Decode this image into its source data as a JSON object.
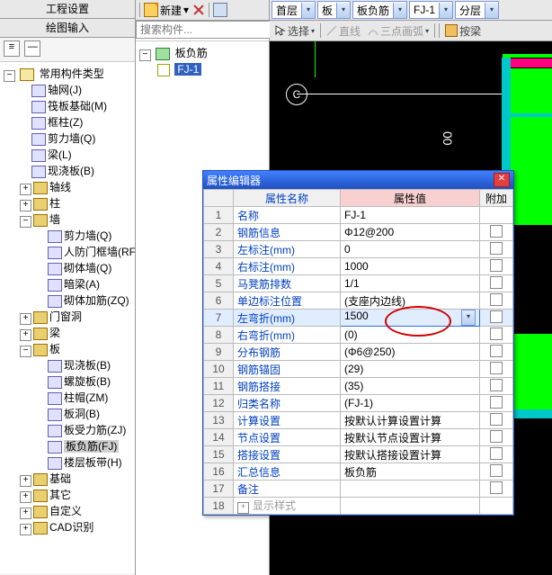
{
  "left": {
    "tab1": "工程设置",
    "tab2": "绘图输入",
    "root": "常用构件类型",
    "items": [
      {
        "label": "轴网(J)"
      },
      {
        "label": "筏板基础(M)"
      },
      {
        "label": "框柱(Z)"
      },
      {
        "label": "剪力墙(Q)"
      },
      {
        "label": "梁(L)"
      },
      {
        "label": "现浇板(B)"
      }
    ],
    "groups": [
      {
        "label": "轴线",
        "exp": "plus"
      },
      {
        "label": "柱",
        "exp": "plus"
      },
      {
        "label": "墙",
        "exp": "minus",
        "children": [
          {
            "label": "剪力墙(Q)"
          },
          {
            "label": "人防门框墙(RF"
          },
          {
            "label": "砌体墙(Q)"
          },
          {
            "label": "暗梁(A)"
          },
          {
            "label": "砌体加筋(ZQ)"
          }
        ]
      },
      {
        "label": "门窗洞",
        "exp": "plus"
      },
      {
        "label": "梁",
        "exp": "plus"
      },
      {
        "label": "板",
        "exp": "minus",
        "children": [
          {
            "label": "现浇板(B)"
          },
          {
            "label": "螺旋板(B)"
          },
          {
            "label": "柱帽(ZM)"
          },
          {
            "label": "板洞(B)"
          },
          {
            "label": "板受力筋(ZJ)"
          },
          {
            "label": "板负筋(FJ)",
            "selected": true
          },
          {
            "label": "楼层板带(H)"
          }
        ]
      },
      {
        "label": "基础",
        "exp": "plus"
      },
      {
        "label": "其它",
        "exp": "plus"
      },
      {
        "label": "自定义",
        "exp": "plus"
      },
      {
        "label": "CAD识别",
        "exp": "plus"
      }
    ]
  },
  "mid": {
    "new_label": "新建",
    "search_placeholder": "搜索构件...",
    "category": "板负筋",
    "item": "FJ-1"
  },
  "top": {
    "combos": [
      "首层",
      "板",
      "板负筋",
      "FJ-1",
      "分层"
    ],
    "select": "选择",
    "line": "直线",
    "arc": "三点画弧",
    "align": "按梁"
  },
  "drawing": {
    "bubble": "C",
    "axis": "00"
  },
  "dialog": {
    "title": "属性编辑器",
    "col_name": "属性名称",
    "col_val": "属性值",
    "col_extra": "附加",
    "rows": [
      {
        "n": "1",
        "name": "名称",
        "val": "FJ-1",
        "cb": false
      },
      {
        "n": "2",
        "name": "钢筋信息",
        "val": "Φ12@200",
        "cb": true
      },
      {
        "n": "3",
        "name": "左标注(mm)",
        "val": "0",
        "cb": true
      },
      {
        "n": "4",
        "name": "右标注(mm)",
        "val": "1000",
        "cb": true
      },
      {
        "n": "5",
        "name": "马凳筋排数",
        "val": "1/1",
        "cb": true
      },
      {
        "n": "6",
        "name": "单边标注位置",
        "val": "(支座内边线)",
        "cb": true
      },
      {
        "n": "7",
        "name": "左弯折(mm)",
        "val": "1500",
        "cb": true,
        "hl": true
      },
      {
        "n": "8",
        "name": "右弯折(mm)",
        "val": "(0)",
        "cb": true
      },
      {
        "n": "9",
        "name": "分布钢筋",
        "val": "(Φ6@250)",
        "cb": true
      },
      {
        "n": "10",
        "name": "钢筋锚固",
        "val": "(29)",
        "cb": true
      },
      {
        "n": "11",
        "name": "钢筋搭接",
        "val": "(35)",
        "cb": true
      },
      {
        "n": "12",
        "name": "归类名称",
        "val": "(FJ-1)",
        "cb": true
      },
      {
        "n": "13",
        "name": "计算设置",
        "val": "按默认计算设置计算",
        "cb": true
      },
      {
        "n": "14",
        "name": "节点设置",
        "val": "按默认节点设置计算",
        "cb": true
      },
      {
        "n": "15",
        "name": "搭接设置",
        "val": "按默认搭接设置计算",
        "cb": true
      },
      {
        "n": "16",
        "name": "汇总信息",
        "val": "板负筋",
        "cb": true
      },
      {
        "n": "17",
        "name": "备注",
        "val": "",
        "cb": true
      },
      {
        "n": "18",
        "name": "显示样式",
        "val": "",
        "plus": true,
        "cb": false,
        "dim": true
      }
    ]
  }
}
